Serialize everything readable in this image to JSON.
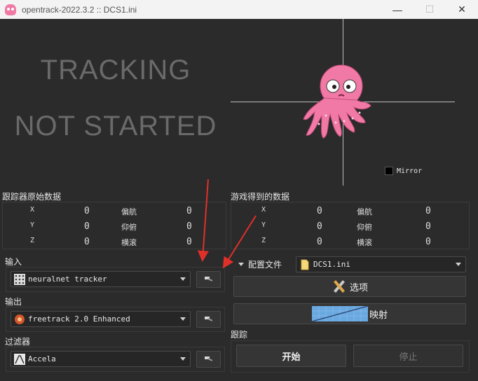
{
  "window": {
    "title": "opentrack-2022.3.2 :: DCS1.ini",
    "minimize": "—",
    "maximize": "☐",
    "close": "✕"
  },
  "status": {
    "line1": "TRACKING",
    "line2": "NOT STARTED"
  },
  "preview": {
    "mirror_label": "Mirror"
  },
  "raw_data": {
    "title": "跟踪器原始数据",
    "rows": [
      {
        "axis": "X",
        "val": "0",
        "name": "偏航",
        "val2": "0"
      },
      {
        "axis": "Y",
        "val": "0",
        "name": "仰俯",
        "val2": "0"
      },
      {
        "axis": "Z",
        "val": "0",
        "name": "横滚",
        "val2": "0"
      }
    ]
  },
  "game_data": {
    "title": "游戏得到的数据",
    "rows": [
      {
        "axis": "X",
        "val": "0",
        "name": "偏航",
        "val2": "0"
      },
      {
        "axis": "Y",
        "val": "0",
        "name": "仰俯",
        "val2": "0"
      },
      {
        "axis": "Z",
        "val": "0",
        "name": "横滚",
        "val2": "0"
      }
    ]
  },
  "input": {
    "label": "输入",
    "value": "neuralnet tracker"
  },
  "output": {
    "label": "输出",
    "value": "freetrack 2.0 Enhanced"
  },
  "filter": {
    "label": "过滤器",
    "value": "Accela"
  },
  "profile": {
    "label": "配置文件",
    "value": "DCS1.ini"
  },
  "buttons": {
    "options": "选项",
    "mapping": "映射",
    "start": "开始",
    "stop": "停止"
  },
  "tracking_group": {
    "label": "跟踪"
  },
  "colors": {
    "background": "#2b2b2b",
    "annotation_arrow": "#e0302a",
    "octopus": "#f07aa5"
  }
}
